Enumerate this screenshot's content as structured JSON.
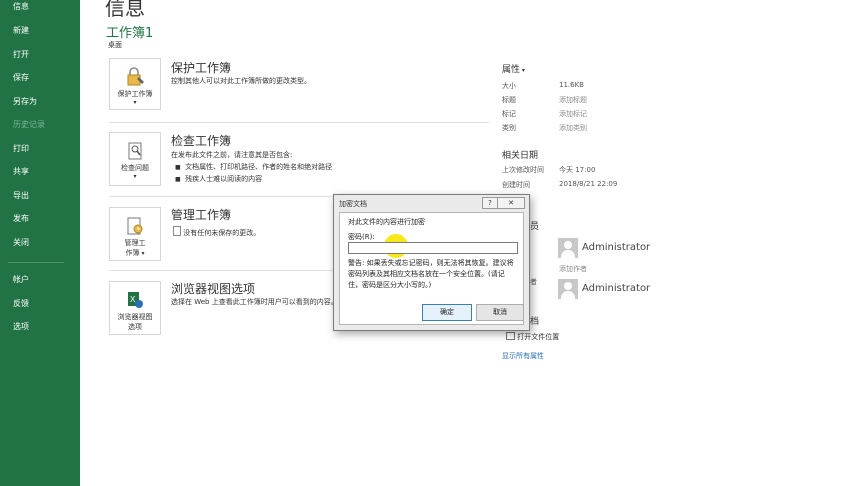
{
  "sidebar": {
    "items": [
      {
        "label": "信息"
      },
      {
        "label": "新建"
      },
      {
        "label": "打开"
      },
      {
        "label": "保存"
      },
      {
        "label": "另存为"
      },
      {
        "label": "历史记录"
      },
      {
        "label": "打印"
      },
      {
        "label": "共享"
      },
      {
        "label": "导出"
      },
      {
        "label": "发布"
      },
      {
        "label": "关闭"
      },
      {
        "label": "帐户"
      },
      {
        "label": "反馈"
      },
      {
        "label": "选项"
      }
    ]
  },
  "header": {
    "page_title": "信息",
    "workbook_name": "工作簿1",
    "location": "桌面"
  },
  "sections": {
    "protect": {
      "button_label": "保护工作簿",
      "title": "保护工作簿",
      "desc": "控制其他人可以对此工作簿所做的更改类型。"
    },
    "inspect": {
      "button_label": "检查问题",
      "title": "检查工作簿",
      "desc": "在发布此文件之前，请注意其是否包含:",
      "bullets": [
        "文档属性、打印机路径、作者的姓名和绝对路径",
        "残疾人士难以阅读的内容"
      ]
    },
    "manage": {
      "button_line1": "管理工",
      "button_line2": "作簿",
      "title": "管理工作簿",
      "desc": "没有任何未保存的更改。"
    },
    "browser": {
      "button_line1": "浏览器视图",
      "button_line2": "选项",
      "title": "浏览器视图选项",
      "desc": "选择在 Web 上查看此工作簿时用户可以看到的内容。"
    }
  },
  "properties": {
    "header": "属性",
    "rows": [
      {
        "label": "大小",
        "value": "11.6KB"
      },
      {
        "label": "标题",
        "value": "添加标题"
      },
      {
        "label": "标记",
        "value": "添加标记"
      },
      {
        "label": "类别",
        "value": "添加类别"
      }
    ],
    "dates_header": "相关日期",
    "dates": [
      {
        "label": "上次修改时间",
        "value": "今天 17:00"
      },
      {
        "label": "创建时间",
        "value": "2018/8/21 22:09"
      }
    ],
    "people_header_tail": "员",
    "author_name": "Administrator",
    "add_author": "添加作者",
    "last_modified_tail": "者",
    "last_modified_name": "Administrator",
    "docs_tail": "档",
    "open_location": "打开文件位置",
    "show_all": "显示所有属性"
  },
  "dialog": {
    "title": "加密文档",
    "help": "?",
    "close": "✕",
    "description": "对此文件的内容进行加密",
    "password_label": "密码(R):",
    "password_value": "",
    "warning": "警告: 如果丢失或忘记密码，则无法将其恢复。建议将密码列表及其相应文档名放在一个安全位置。(请记住，密码是区分大小写的。)",
    "ok": "确定",
    "cancel": "取消"
  },
  "colors": {
    "brand_green": "#217346",
    "cursor_highlight": "#f5e600"
  }
}
